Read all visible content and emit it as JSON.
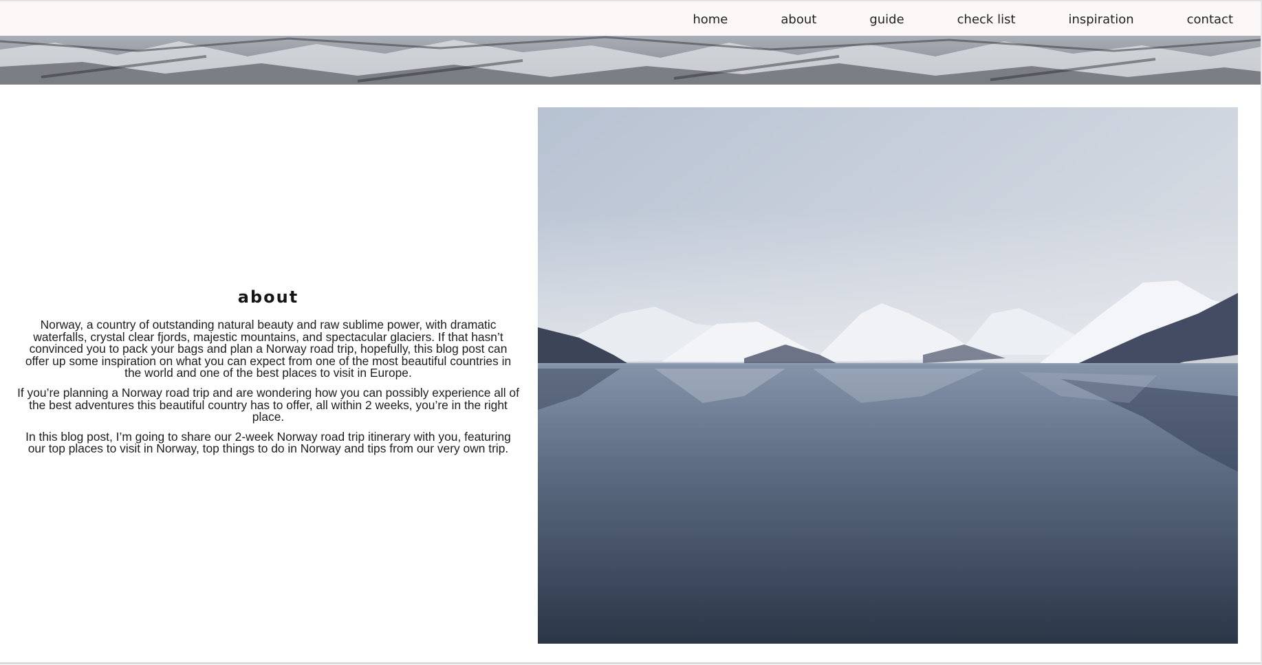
{
  "nav": {
    "items": [
      {
        "label": "home"
      },
      {
        "label": "about"
      },
      {
        "label": "guide"
      },
      {
        "label": "check list"
      },
      {
        "label": "inspiration"
      },
      {
        "label": "contact"
      }
    ]
  },
  "about": {
    "title": "about",
    "paragraphs": [
      "Norway, a country of outstanding natural beauty and raw sublime power, with dramatic waterfalls, crystal clear fjords, majestic mountains, and spectacular glaciers. If that hasn’t convinced you to pack your bags and plan a Norway road trip, hopefully, this blog post can offer up some inspiration on what you can expect from one of the most beautiful countries in the world and one of the best places to visit in Europe.",
      "If you’re planning a Norway road trip and are wondering how you can possibly experience all of the best adventures this beautiful country has to offer, all within 2 weeks, you’re in the right place.",
      "In this blog post, I’m going to share our 2-week Norway road trip itinerary with you, featuring our top places to visit in Norway, top things to do in Norway and tips from our very own trip."
    ]
  },
  "colors": {
    "nav_background": "#fcf8f7",
    "text": "#1c1c1c"
  }
}
